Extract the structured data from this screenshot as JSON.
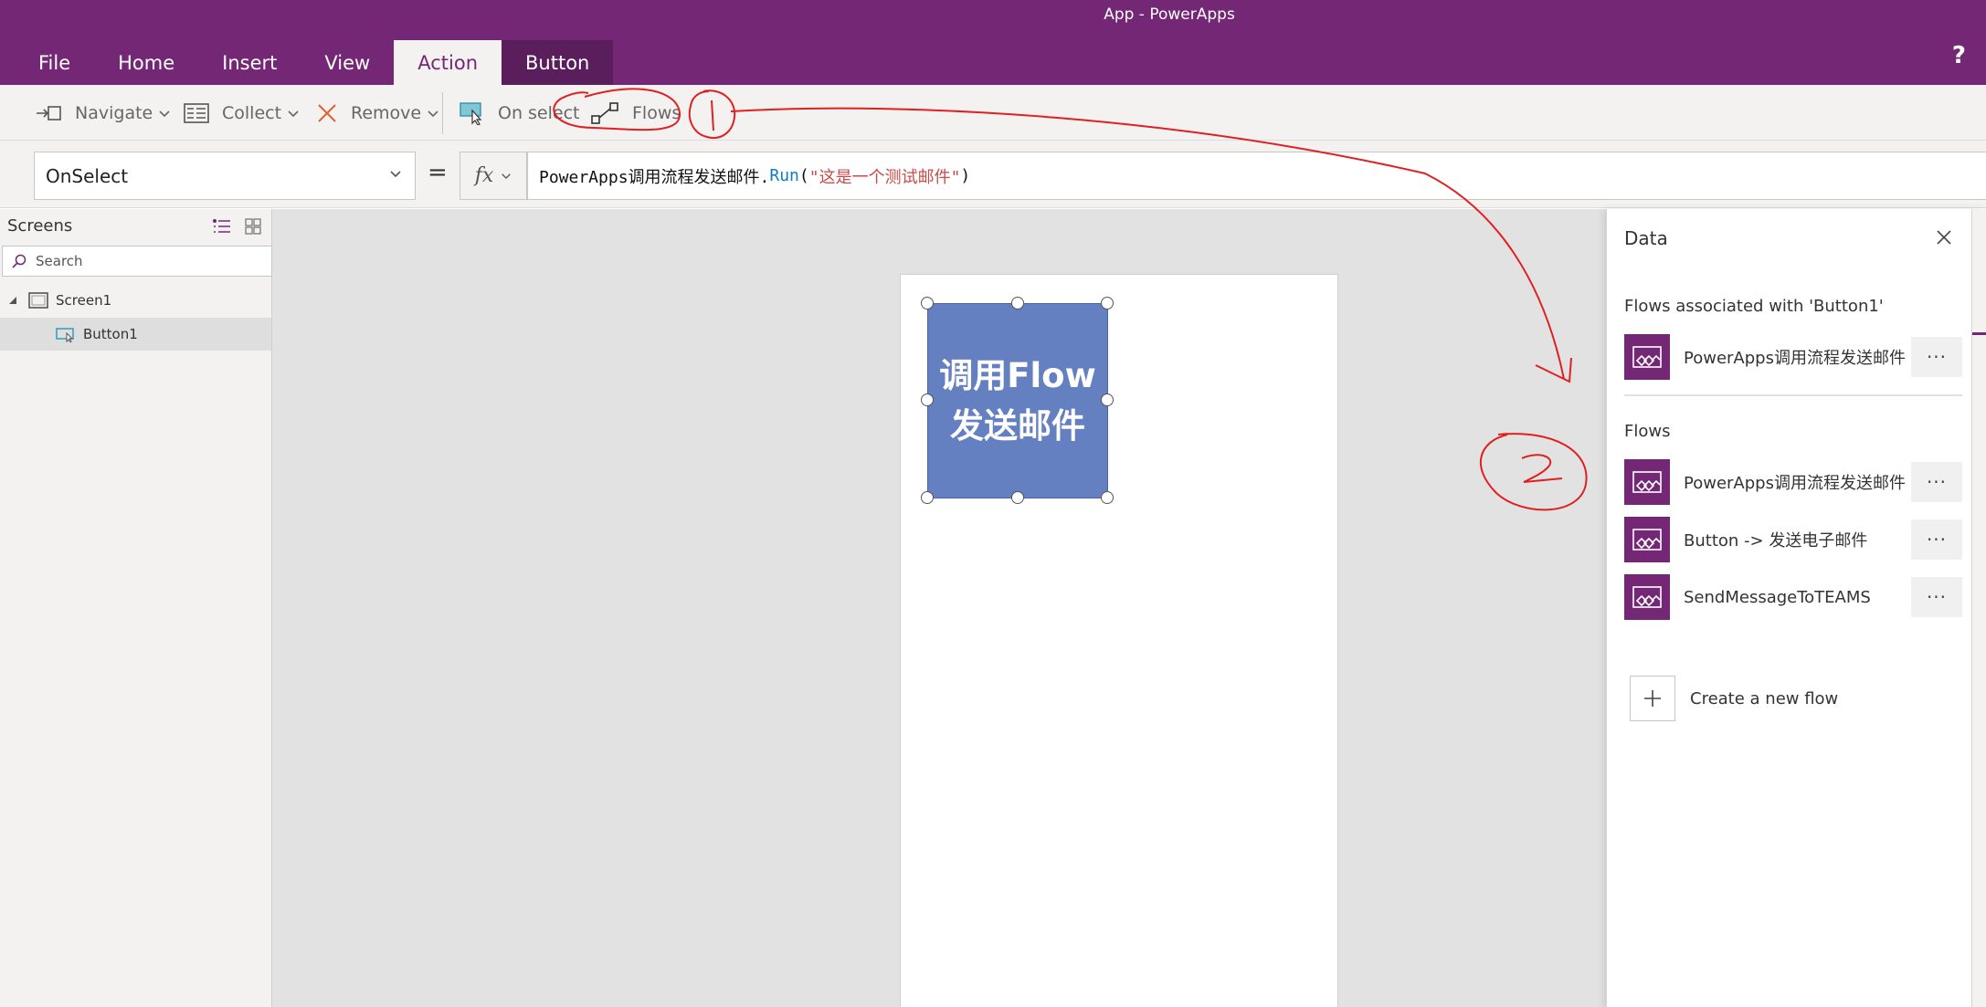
{
  "window": {
    "title": "App - PowerApps",
    "help_glyph": "?"
  },
  "tabs": [
    {
      "label": "File"
    },
    {
      "label": "Home"
    },
    {
      "label": "Insert"
    },
    {
      "label": "View"
    },
    {
      "label": "Action"
    },
    {
      "label": "Button"
    }
  ],
  "ribbon": {
    "navigate": "Navigate",
    "collect": "Collect",
    "remove": "Remove",
    "on_select": "On select",
    "flows": "Flows"
  },
  "formula_bar": {
    "property": "OnSelect",
    "equals": "=",
    "fx": "fx",
    "formula": {
      "prefix": "PowerApps调用流程发送邮件.",
      "function": "Run",
      "open": "(",
      "string": "\"这是一个测试邮件\"",
      "close": ")"
    }
  },
  "left_panel": {
    "title": "Screens",
    "search_placeholder": "Search",
    "tree": [
      {
        "label": "Screen1",
        "type": "screen",
        "expanded": true
      },
      {
        "label": "Button1",
        "type": "button",
        "selected": true
      }
    ]
  },
  "canvas": {
    "button_text_line1": "调用Flow",
    "button_text_line2": "发送邮件",
    "button_color": "#6580c0"
  },
  "data_pane": {
    "title": "Data",
    "associated_heading": "Flows associated with 'Button1'",
    "associated_flows": [
      {
        "name": "PowerApps调用流程发送邮件"
      }
    ],
    "flows_heading": "Flows",
    "flows": [
      {
        "name": "PowerApps调用流程发送邮件"
      },
      {
        "name": "Button -> 发送电子邮件"
      },
      {
        "name": "SendMessageToTEAMS"
      }
    ],
    "more_glyph": "···",
    "create_label": "Create a new flow"
  },
  "colors": {
    "brand": "#742774",
    "annotation": "#e02020",
    "formula_function": "#0f7ac7",
    "formula_string": "#c94a4a"
  },
  "annotations": [
    "1",
    "2"
  ]
}
